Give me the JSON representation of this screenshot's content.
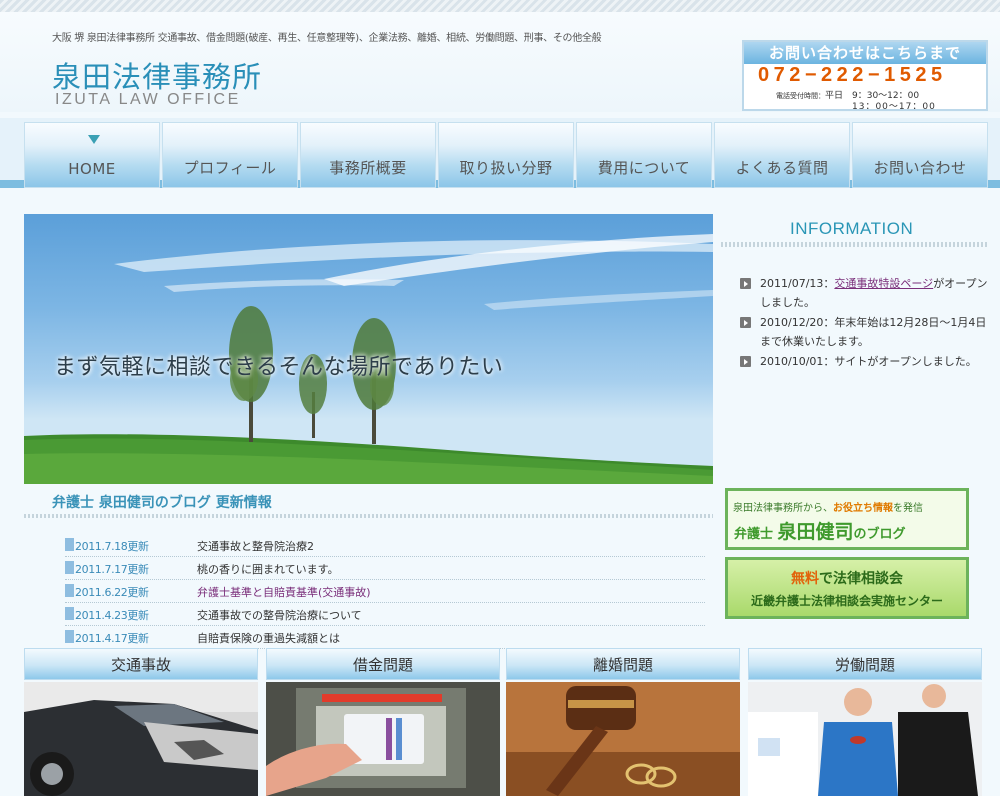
{
  "header": {
    "tagline": "大阪 堺 泉田法律事務所 交通事故、借金問題(破産、再生、任意整理等)、企業法務、離婚、相続、労働問題、刑事、その他全般",
    "logo_jp": "泉田法律事務所",
    "logo_en": "IZUTA LAW OFFICE",
    "contact_title": "お問い合わせはこちらまで",
    "phone": "072−222−1525",
    "hours_label": "電話受付時間：",
    "hours_line1": "平日　9：30〜12：00",
    "hours_line2": "13：00〜17：00"
  },
  "nav": [
    {
      "label": "HOME"
    },
    {
      "label": "プロフィール"
    },
    {
      "label": "事務所概要"
    },
    {
      "label": "取り扱い分野"
    },
    {
      "label": "費用について"
    },
    {
      "label": "よくある質問"
    },
    {
      "label": "お問い合わせ"
    }
  ],
  "hero": {
    "caption": "まず気軽に相談できるそんな場所でありたい"
  },
  "blog": {
    "heading": "弁護士 泉田健司のブログ 更新情報",
    "items": [
      {
        "date": "2011.7.18更新",
        "title": "交通事故と整骨院治療2"
      },
      {
        "date": "2011.7.17更新",
        "title": "桃の香りに囲まれています。"
      },
      {
        "date": "2011.6.22更新",
        "title": "弁護士基準と自賠責基準(交通事故)"
      },
      {
        "date": "2011.4.23更新",
        "title": "交通事故での整骨院治療について"
      },
      {
        "date": "2011.4.17更新",
        "title": "自賠責保険の重過失減額とは"
      }
    ]
  },
  "info": {
    "heading": "INFORMATION",
    "items": [
      {
        "date": "2011/07/13：",
        "link": "交通事故特設ページ",
        "text": "がオープンしました。"
      },
      {
        "date": "2010/12/20：",
        "link": "",
        "text": "年末年始は12月28日〜1月4日まで休業いたします。"
      },
      {
        "date": "2010/10/01：",
        "link": "",
        "text": "サイトがオープンしました。"
      }
    ]
  },
  "banners": {
    "blog_line1_a": "泉田法律事務所から、",
    "blog_line1_b": "お役立ち情報",
    "blog_line1_c": "を発信",
    "blog_line2_a": "弁護士 ",
    "blog_line2_b": "泉田健司",
    "blog_line2_c": "のブログ",
    "consult_free": "無料",
    "consult_line1": "で法律相談会",
    "consult_line2": "近畿弁護士法律相談会実施センター"
  },
  "categories": [
    {
      "label": "交通事故"
    },
    {
      "label": "借金問題"
    },
    {
      "label": "離婚問題"
    },
    {
      "label": "労働問題"
    }
  ]
}
